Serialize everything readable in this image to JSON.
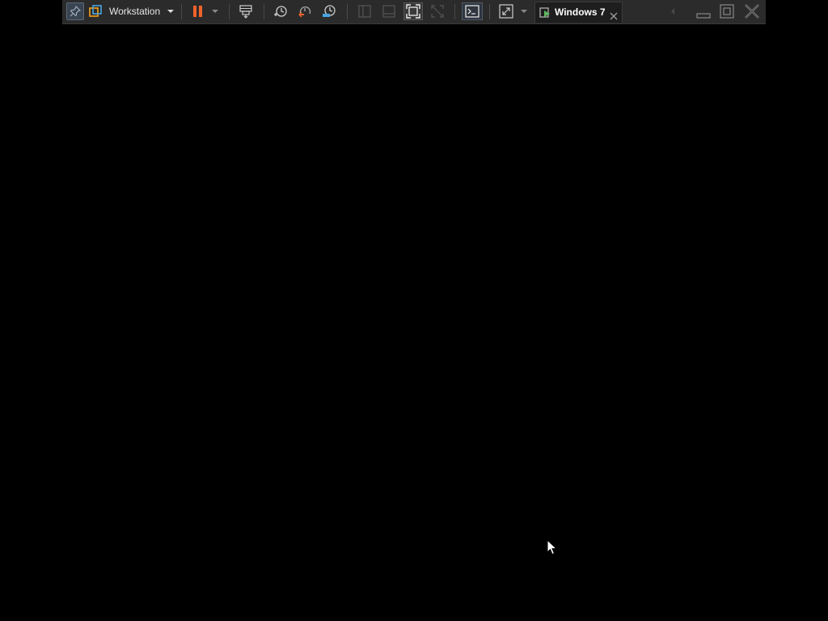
{
  "toolbar": {
    "workstation_label": "Workstation",
    "vm_tab_label": "Windows 7"
  },
  "icons": {
    "pin": "pin-icon",
    "workstation_logo": "vmware-workstation-icon",
    "workstation_menu": "chevron-down-icon",
    "pause": "pause-icon",
    "power_menu": "chevron-down-icon",
    "send_ctrl_alt_del": "send-keys-icon",
    "snapshot_take": "snapshot-take-icon",
    "snapshot_revert": "snapshot-revert-icon",
    "snapshot_manager": "snapshot-manager-icon",
    "view_library": "library-icon",
    "view_thumbnail": "thumbnail-bar-icon",
    "view_full_screen": "full-screen-icon",
    "view_unity": "unity-icon",
    "console": "console-icon",
    "stretch": "stretch-icon",
    "stretch_menu": "chevron-down-icon",
    "vm_tab": "vm-running-icon",
    "close_tab": "close-icon",
    "scroll_left": "chevron-left-icon",
    "minimize": "minimize-icon",
    "restore": "restore-icon",
    "close": "close-icon",
    "cursor": "mouse-pointer-icon"
  },
  "colors": {
    "toolbar_bg": "#2b2b2b",
    "accent_orange": "#f0632a",
    "accent_blue": "#4aa3df",
    "screen_bg": "#000000"
  }
}
